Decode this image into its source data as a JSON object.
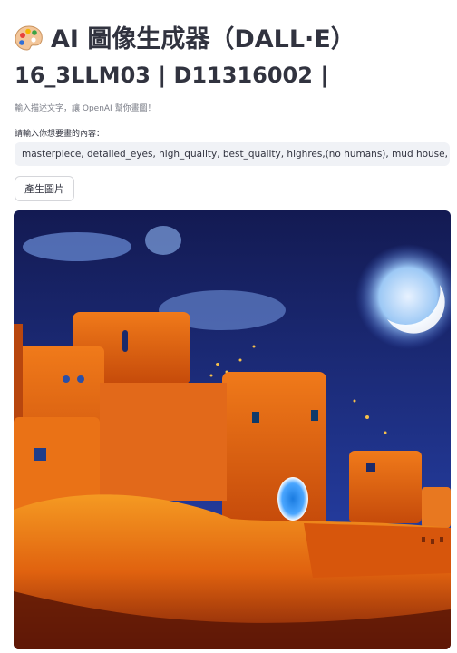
{
  "app": {
    "title": "AI 圖像生成器（DALL·E）",
    "subtitle": "16_3LLM03 | D11316002 |",
    "caption": "輸入描述文字，讓 OpenAI 幫你畫圖！"
  },
  "prompt": {
    "label": "請輸入你想要畫的內容：",
    "value": "masterpiece, detailed_eyes, high_quality, best_quality, highres,(no humans), mud house, clay house, h"
  },
  "generate_button": {
    "label": "產生圖片"
  },
  "icons": {
    "title_icon": "artist-palette-icon"
  },
  "colors": {
    "text": "#31333f",
    "caption": "#7a7d87",
    "input_bg": "#f0f2f6",
    "sky_top": "#131a52",
    "sky_bottom": "#233a9a",
    "house_orange": "#e0620f"
  }
}
